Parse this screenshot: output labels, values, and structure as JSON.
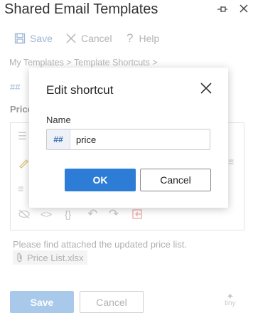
{
  "header": {
    "title": "Shared Email Templates"
  },
  "toolbar": {
    "save_label": "Save",
    "cancel_label": "Cancel",
    "help_label": "Help"
  },
  "breadcrumb": "My Templates > Template Shortcuts >",
  "background": {
    "hash": "##",
    "price_label": "Price",
    "body_text": "Please find attached the updated price list.",
    "attachment": "Price List.xlsx"
  },
  "footer": {
    "save_label": "Save",
    "cancel_label": "Cancel",
    "brand": "tiny"
  },
  "dialog": {
    "title": "Edit shortcut",
    "name_label": "Name",
    "prefix": "##",
    "name_value": "price",
    "ok_label": "OK",
    "cancel_label": "Cancel"
  },
  "colors": {
    "accent": "#2d7cd6",
    "disabled_save": "#a9c9ea"
  }
}
